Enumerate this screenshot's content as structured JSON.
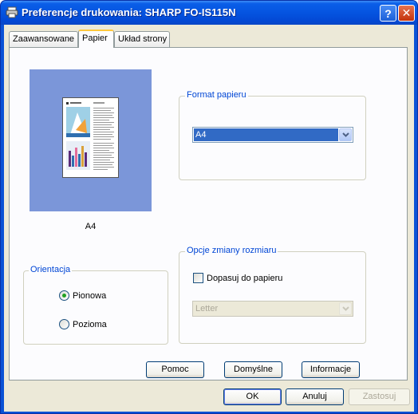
{
  "window": {
    "title": "Preferencje drukowania: SHARP FO-IS115N"
  },
  "titlebar_buttons": {
    "help": "?",
    "close": "✕"
  },
  "tabs": [
    {
      "label": "Zaawansowane"
    },
    {
      "label": "Papier",
      "active": true
    },
    {
      "label": "Układ strony"
    }
  ],
  "preview": {
    "label": "A4"
  },
  "paper_format": {
    "legend": "Format papieru",
    "value": "A4"
  },
  "resize_options": {
    "legend": "Opcje zmiany rozmiaru",
    "fit_to_paper_label": "Dopasuj do papieru",
    "fit_to_paper_checked": false,
    "size_value": "Letter"
  },
  "orientation": {
    "legend": "Orientacja",
    "options": [
      {
        "label": "Pionowa",
        "checked": true
      },
      {
        "label": "Pozioma",
        "checked": false
      }
    ]
  },
  "panel_buttons": {
    "help": "Pomoc",
    "defaults": "Domyślne",
    "info": "Informacje"
  },
  "dialog_buttons": {
    "ok": "OK",
    "cancel": "Anuluj",
    "apply": "Zastosuj"
  },
  "icons": [
    "printer-icon",
    "help-icon",
    "close-icon",
    "chevron-down-icon"
  ],
  "colors": {
    "titlebar": "#0554e0",
    "preview_bg": "#7b96d9",
    "legend_text": "#0046d5",
    "selection": "#316ac5"
  }
}
